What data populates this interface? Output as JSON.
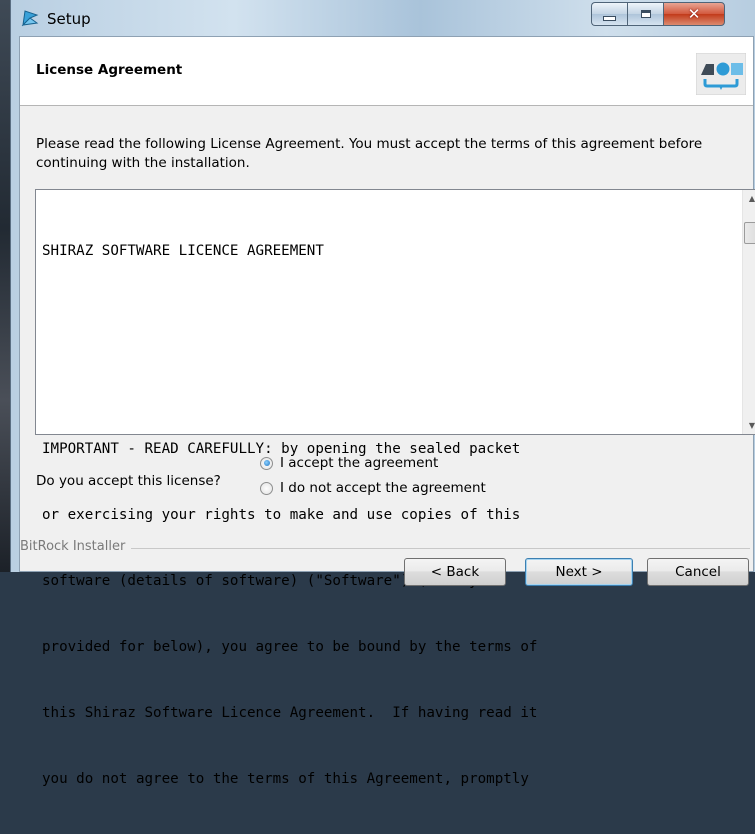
{
  "window": {
    "title": "Setup"
  },
  "header": {
    "title": "License Agreement",
    "logo_icon": "installer-logo-icon"
  },
  "intro_text": "Please read the following License Agreement. You must accept the terms of this agreement before continuing with the installation.",
  "license_lines": [
    "SHIRAZ SOFTWARE LICENCE AGREEMENT",
    "",
    "",
    "IMPORTANT - READ CAREFULLY: by opening the sealed packet",
    "or exercising your rights to make and use copies of this",
    "software (details of software) (\"Software\") (as may be",
    "provided for below), you agree to be bound by the terms of",
    "this Shiraz Software Licence Agreement.  If having read it",
    "you do not agree to the terms of this Agreement, promptly"
  ],
  "accept": {
    "question": "Do you accept this license?",
    "options": [
      {
        "label": "I accept the agreement",
        "selected": true
      },
      {
        "label": "I do not accept the agreement",
        "selected": false
      }
    ]
  },
  "footer": {
    "brand": "BitRock Installer",
    "back_label": "< Back",
    "next_label": "Next >",
    "cancel_label": "Cancel"
  },
  "colors": {
    "close_button": "#c8452a",
    "header_bg": "#ffffff",
    "dialog_bg": "#f0f0f0"
  }
}
